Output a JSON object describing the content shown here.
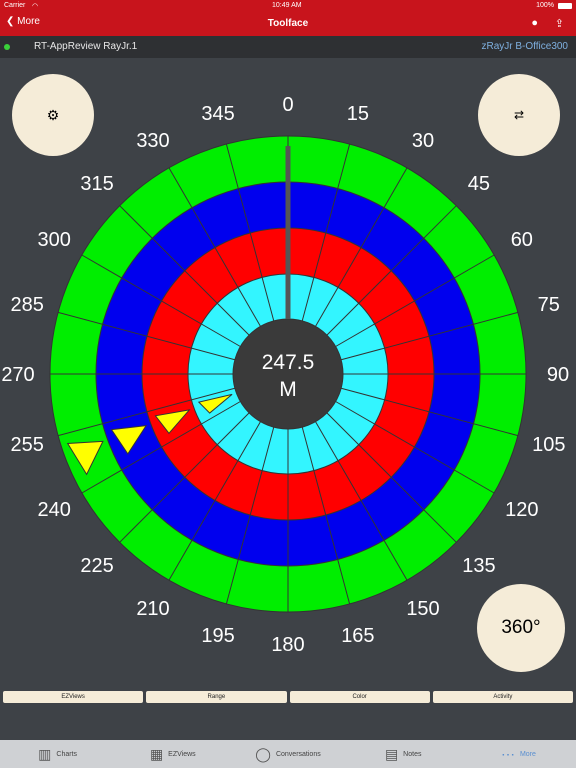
{
  "status": {
    "carrier": "Carrier",
    "time": "10:49 AM",
    "battery": "100%"
  },
  "nav": {
    "back_label": "More",
    "title": "Toolface",
    "icons": {
      "bulb": "lightbulb-icon",
      "share": "share-icon"
    }
  },
  "info": {
    "left": "RT-AppReview RayJr.1",
    "right": "zRayJr B-Office300",
    "status_color": "#3ad13a"
  },
  "controls": {
    "settings_icon": "gear-icon",
    "swap_icon": "swap-arrows-icon",
    "range_label": "360°"
  },
  "chart_data": {
    "type": "polar-toolface",
    "center_value": "247.5",
    "center_unit": "M",
    "angle_labels": [
      "0",
      "15",
      "30",
      "45",
      "60",
      "75",
      "90",
      "105",
      "120",
      "135",
      "150",
      "165",
      "180",
      "195",
      "210",
      "225",
      "240",
      "255",
      "270",
      "285",
      "300",
      "315",
      "330",
      "345"
    ],
    "rings": [
      {
        "color": "#00ee00"
      },
      {
        "color": "#0000ee"
      },
      {
        "color": "#ff0000"
      },
      {
        "color": "#33f5ff"
      }
    ],
    "pointer_angle": 0,
    "markers": [
      {
        "ring": 1,
        "angle": 247.5
      },
      {
        "ring": 2,
        "angle": 247.5
      },
      {
        "ring": 3,
        "angle": 247.5
      },
      {
        "ring": 4,
        "angle": 247.5
      }
    ],
    "marker_color": "#ffff00"
  },
  "segments": [
    "EZViews",
    "Range",
    "Color",
    "Activity"
  ],
  "tabs": [
    {
      "label": "Charts",
      "icon": "bar-chart-icon"
    },
    {
      "label": "EZViews",
      "icon": "grid-icon"
    },
    {
      "label": "Conversations",
      "icon": "speech-bubble-icon"
    },
    {
      "label": "Notes",
      "icon": "notes-icon"
    },
    {
      "label": "More",
      "icon": "more-dots-icon"
    }
  ]
}
